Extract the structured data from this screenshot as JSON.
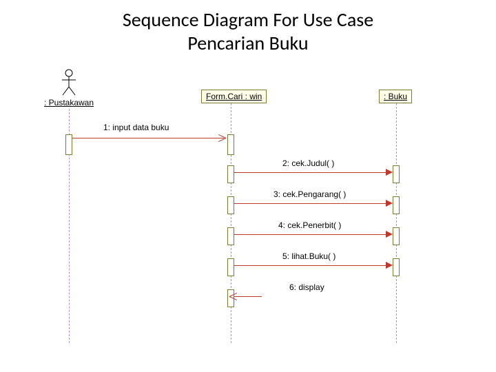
{
  "title_line1": "Sequence Diagram For Use Case",
  "title_line2": "Pencarian Buku",
  "actor_label": ": Pustakawan",
  "object_form": "Form.Cari : win",
  "object_buku": ": Buku",
  "messages": {
    "m1": "1: input data buku",
    "m2": "2: cek.Judul( )",
    "m3": "3: cek.Pengarang( )",
    "m4": "4: cek.Penerbit( )",
    "m5": "5: lihat.Buku( )",
    "m6": "6: display"
  }
}
